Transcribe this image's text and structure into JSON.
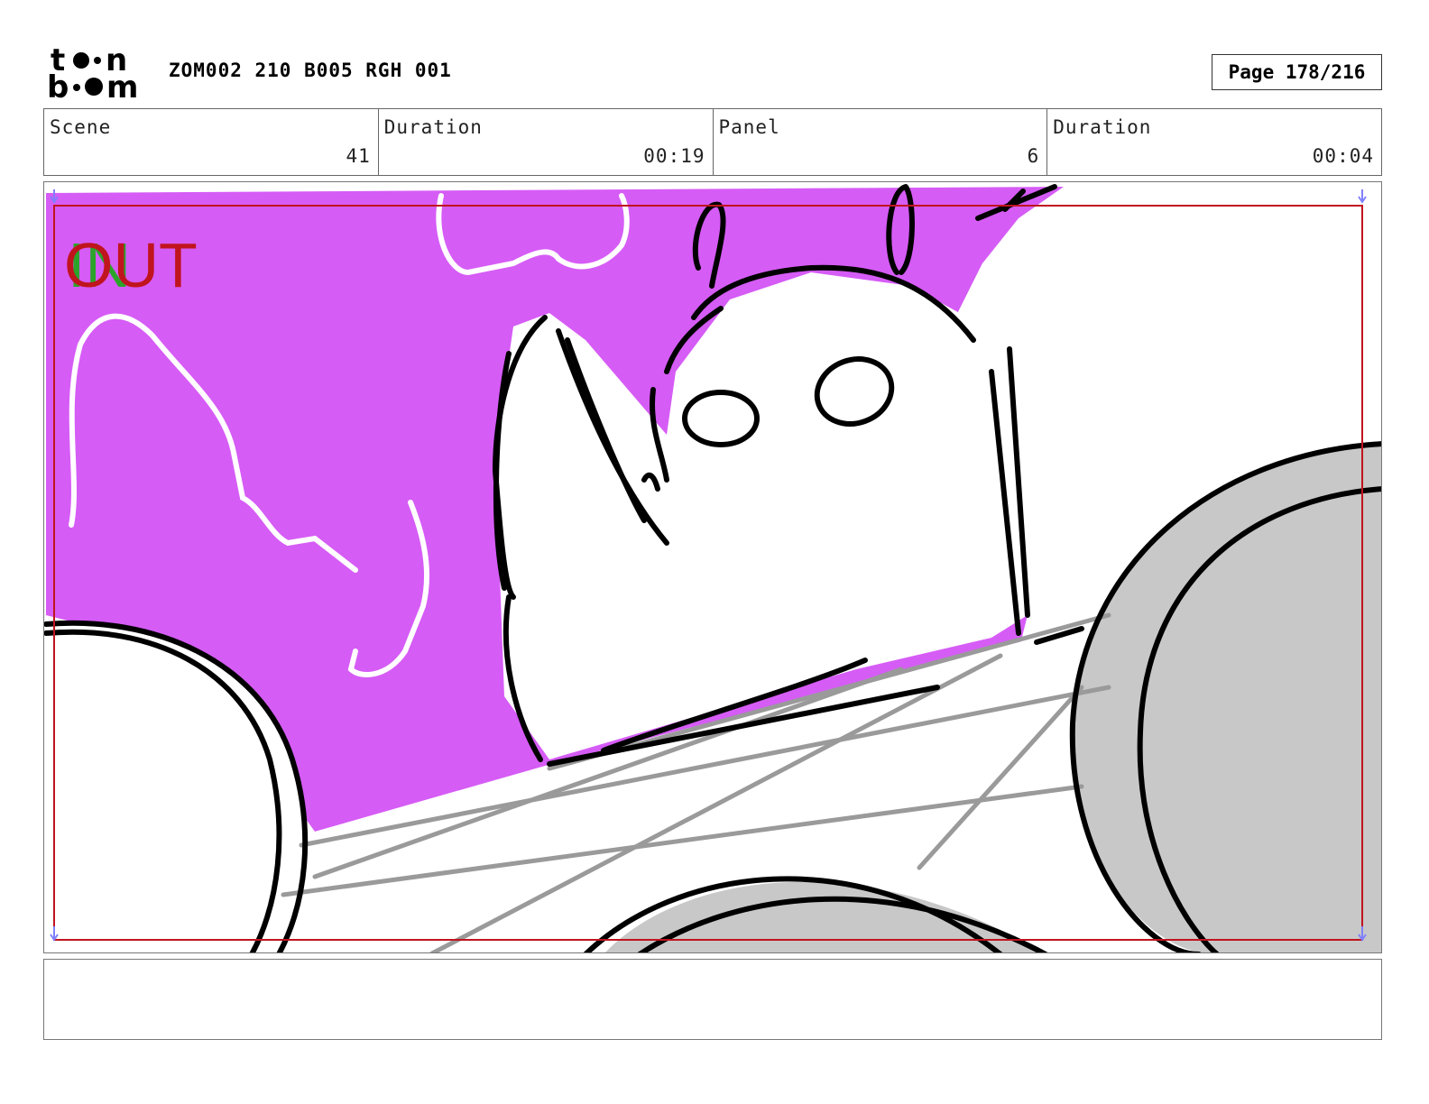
{
  "header": {
    "logo_text": "toon boom",
    "doc_title": "ZOM002 210 B005 RGH 001",
    "page_label": "Page 178/216"
  },
  "info": {
    "scene_label": "Scene",
    "scene_value": "41",
    "scene_duration_label": "Duration",
    "scene_duration_value": "00:19",
    "panel_label": "Panel",
    "panel_value": "6",
    "panel_duration_label": "Duration",
    "panel_duration_value": "00:04"
  },
  "panel": {
    "in_marker": "IN",
    "out_marker": "OUT",
    "colors": {
      "background_fill": "#d65cf6",
      "wheel_fill": "#c8c8c8",
      "safe_frame": "#c0141e",
      "in_color": "#2aa52a",
      "out_color": "#c0141e",
      "ink": "#000000",
      "construction": "#9a9a9a"
    }
  },
  "notes": {
    "text": ""
  }
}
